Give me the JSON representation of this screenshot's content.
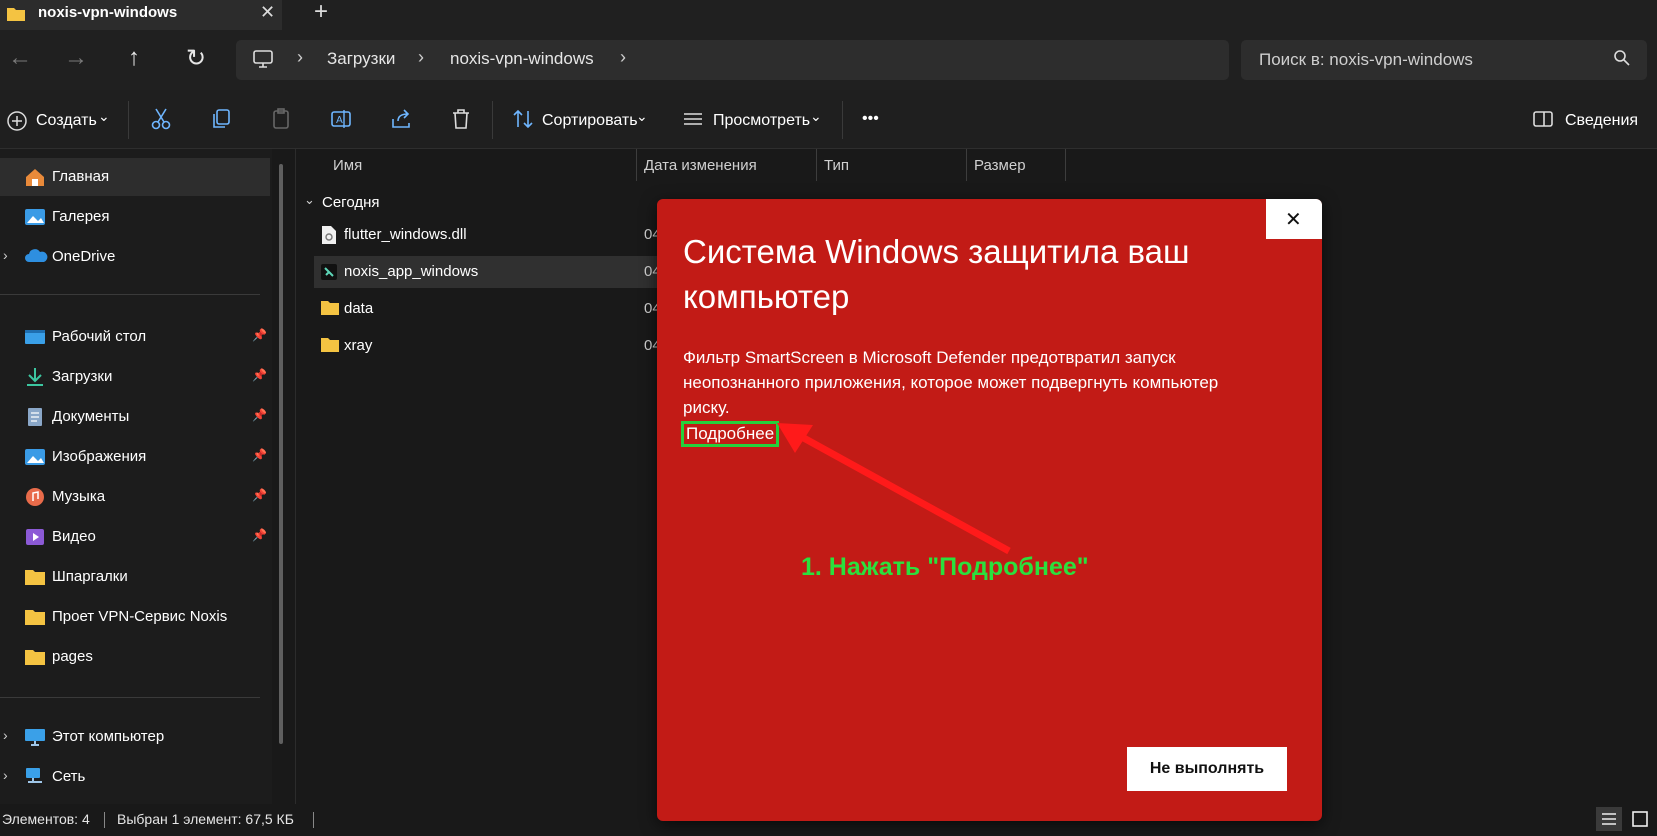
{
  "tab": {
    "title": "noxis-vpn-windows",
    "close": "✕",
    "new_tab": "+"
  },
  "nav": {
    "back": "←",
    "forward": "→",
    "up": "↑",
    "refresh": "↻"
  },
  "breadcrumb": {
    "items": [
      "Загрузки",
      "noxis-vpn-windows"
    ],
    "sep": "›"
  },
  "search": {
    "placeholder": "Поиск в: noxis-vpn-windows"
  },
  "toolbar": {
    "create": "Создать",
    "sort": "Сортировать",
    "view": "Просмотреть",
    "more": "•••",
    "details": "Сведения",
    "dropdown": "⌄"
  },
  "sidebar": {
    "items": [
      {
        "label": "Главная",
        "icon": "home-icon"
      },
      {
        "label": "Галерея",
        "icon": "gallery-icon"
      },
      {
        "label": "OneDrive",
        "icon": "onedrive-icon"
      },
      {
        "label": "Рабочий стол",
        "icon": "desktop-icon"
      },
      {
        "label": "Загрузки",
        "icon": "download-icon"
      },
      {
        "label": "Документы",
        "icon": "documents-icon"
      },
      {
        "label": "Изображения",
        "icon": "pictures-icon"
      },
      {
        "label": "Музыка",
        "icon": "music-icon"
      },
      {
        "label": "Видео",
        "icon": "video-icon"
      },
      {
        "label": "Шпаргалки",
        "icon": "folder-icon"
      },
      {
        "label": "Проет VPN-Сервис Noxis",
        "icon": "folder-icon"
      },
      {
        "label": "pages",
        "icon": "folder-icon"
      },
      {
        "label": "Этот компьютер",
        "icon": "computer-icon"
      },
      {
        "label": "Сеть",
        "icon": "network-icon"
      }
    ]
  },
  "columns": {
    "name": "Имя",
    "date": "Дата изменения",
    "type": "Тип",
    "size": "Размер"
  },
  "group": {
    "label": "Сегодня"
  },
  "files": [
    {
      "name": "flutter_windows.dll",
      "date": "04"
    },
    {
      "name": "noxis_app_windows",
      "date": "04"
    },
    {
      "name": "data",
      "date": "04"
    },
    {
      "name": "xray",
      "date": "04"
    }
  ],
  "status": {
    "count": "Элементов: 4",
    "selection": "Выбран 1 элемент: 67,5 КБ"
  },
  "dialog": {
    "title": "Система Windows защитила ваш компьютер",
    "body": "Фильтр SmartScreen в Microsoft Defender предотвратил запуск неопознанного приложения, которое может подвергнуть компьютер риску.",
    "more_link": "Подробнее",
    "annotation": "1. Нажать \"Подробнее\"",
    "dont_run": "Не выполнять",
    "close": "✕"
  },
  "colors": {
    "dialog_bg": "#c21b16",
    "highlight": "#25d13b",
    "annotation": "#2be03d",
    "arrow": "#ff1a1a"
  }
}
